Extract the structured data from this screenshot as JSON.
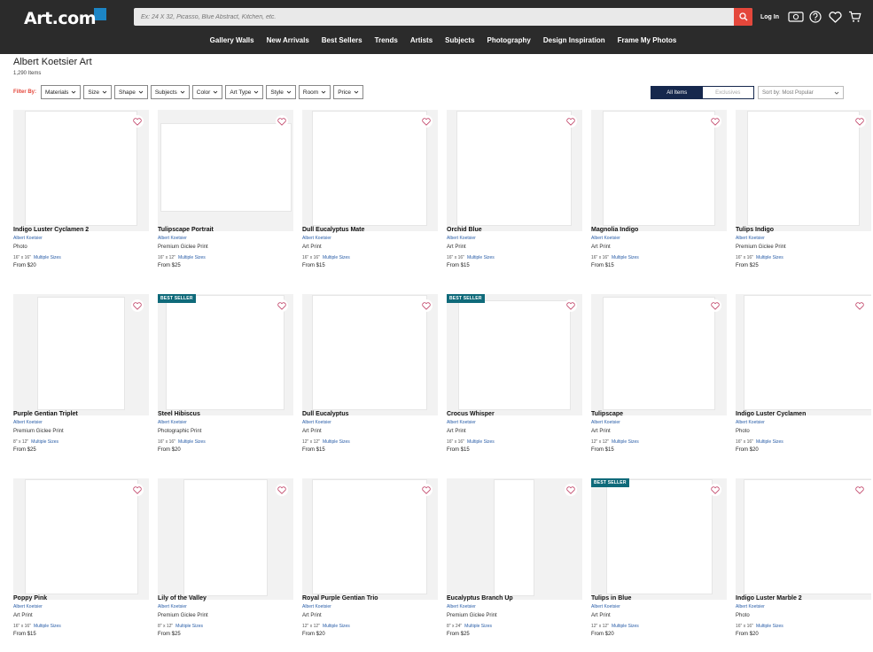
{
  "brand": {
    "logo": "Art.com",
    "accent": "#e4473b",
    "logo_square": "#1b8fd6"
  },
  "search": {
    "placeholder": "Ex: 24 X 32, Picasso, Blue Abstract, Kitchen, etc."
  },
  "header": {
    "login": "Log In",
    "icons": [
      "currency-icon",
      "help-icon",
      "heart-icon",
      "cart-icon"
    ]
  },
  "nav": [
    "Gallery Walls",
    "New Arrivals",
    "Best Sellers",
    "Trends",
    "Artists",
    "Subjects",
    "Photography",
    "Design Inspiration",
    "Frame My Photos"
  ],
  "page": {
    "title": "Albert Koetsier Art",
    "count": "1,290 Items"
  },
  "filters": {
    "label": "Filter By:",
    "items": [
      "Materials",
      "Size",
      "Shape",
      "Subjects",
      "Color",
      "Art Type",
      "Style",
      "Room",
      "Price"
    ]
  },
  "toggle": {
    "all": "All Items",
    "exclusive": "Exclusives"
  },
  "sort": {
    "value": "Sort by: Most Popular"
  },
  "products": [
    {
      "title": "Indigo Luster Cyclamen 2",
      "artist": "Albert Koetsier",
      "type": "Photo",
      "size": "16\" x 16\"",
      "multi": "Multiple Sizes",
      "price": "From $20",
      "badge": ""
    },
    {
      "title": "Tulipscape Portrait",
      "artist": "Albert Koetsier",
      "type": "Premium Giclee Print",
      "size": "16\" x 12\"",
      "multi": "Multiple Sizes",
      "price": "From $25",
      "badge": ""
    },
    {
      "title": "Dull Eucalyptus Mate",
      "artist": "Albert Koetsier",
      "type": "Art Print",
      "size": "16\" x 16\"",
      "multi": "Multiple Sizes",
      "price": "From $15",
      "badge": ""
    },
    {
      "title": "Orchid Blue",
      "artist": "Albert Koetsier",
      "type": "Art Print",
      "size": "16\" x 16\"",
      "multi": "Multiple Sizes",
      "price": "From $15",
      "badge": ""
    },
    {
      "title": "Magnolia Indigo",
      "artist": "Albert Koetsier",
      "type": "Art Print",
      "size": "16\" x 16\"",
      "multi": "Multiple Sizes",
      "price": "From $15",
      "badge": ""
    },
    {
      "title": "Tulips Indigo",
      "artist": "Albert Koetsier",
      "type": "Premium Giclee Print",
      "size": "16\" x 16\"",
      "multi": "Multiple Sizes",
      "price": "From $25",
      "badge": ""
    },
    {
      "title": "Purple Gentian Triplet",
      "artist": "Albert Koetsier",
      "type": "Premium Giclee Print",
      "size": "8\" x 12\"",
      "multi": "Multiple Sizes",
      "price": "From $25",
      "badge": ""
    },
    {
      "title": "Steel Hibiscus",
      "artist": "Albert Koetsier",
      "type": "Photographic Print",
      "size": "16\" x 16\"",
      "multi": "Multiple Sizes",
      "price": "From $20",
      "badge": "BEST SELLER"
    },
    {
      "title": "Dull Eucalyptus",
      "artist": "Albert Koetsier",
      "type": "Art Print",
      "size": "12\" x 12\"",
      "multi": "Multiple Sizes",
      "price": "From $15",
      "badge": ""
    },
    {
      "title": "Crocus Whisper",
      "artist": "Albert Koetsier",
      "type": "Art Print",
      "size": "16\" x 16\"",
      "multi": "Multiple Sizes",
      "price": "From $15",
      "badge": "BEST SELLER"
    },
    {
      "title": "Tulipscape",
      "artist": "Albert Koetsier",
      "type": "Art Print",
      "size": "12\" x 12\"",
      "multi": "Multiple Sizes",
      "price": "From $15",
      "badge": ""
    },
    {
      "title": "Indigo Luster Cyclamen",
      "artist": "Albert Koetsier",
      "type": "Photo",
      "size": "16\" x 16\"",
      "multi": "Multiple Sizes",
      "price": "From $20",
      "badge": ""
    },
    {
      "title": "Poppy Pink",
      "artist": "Albert Koetsier",
      "type": "Art Print",
      "size": "16\" x 16\"",
      "multi": "Multiple Sizes",
      "price": "From $15",
      "badge": ""
    },
    {
      "title": "Lily of the Valley",
      "artist": "Albert Koetsier",
      "type": "Premium Giclee Print",
      "size": "8\" x 12\"",
      "multi": "Multiple Sizes",
      "price": "From $25",
      "badge": ""
    },
    {
      "title": "Royal Purple Gentian Trio",
      "artist": "Albert Koetsier",
      "type": "Art Print",
      "size": "12\" x 12\"",
      "multi": "Multiple Sizes",
      "price": "From $20",
      "badge": ""
    },
    {
      "title": "Eucalyptus Branch Up",
      "artist": "Albert Koetsier",
      "type": "Premium Giclee Print",
      "size": "8\" x 24\"",
      "multi": "Multiple Sizes",
      "price": "From $25",
      "badge": ""
    },
    {
      "title": "Tulips in Blue",
      "artist": "Albert Koetsier",
      "type": "Art Print",
      "size": "12\" x 12\"",
      "multi": "Multiple Sizes",
      "price": "From $20",
      "badge": "BEST SELLER"
    },
    {
      "title": "Indigo Luster Marble 2",
      "artist": "Albert Koetsier",
      "type": "Photo",
      "size": "16\" x 16\"",
      "multi": "Multiple Sizes",
      "price": "From $20",
      "badge": ""
    }
  ]
}
